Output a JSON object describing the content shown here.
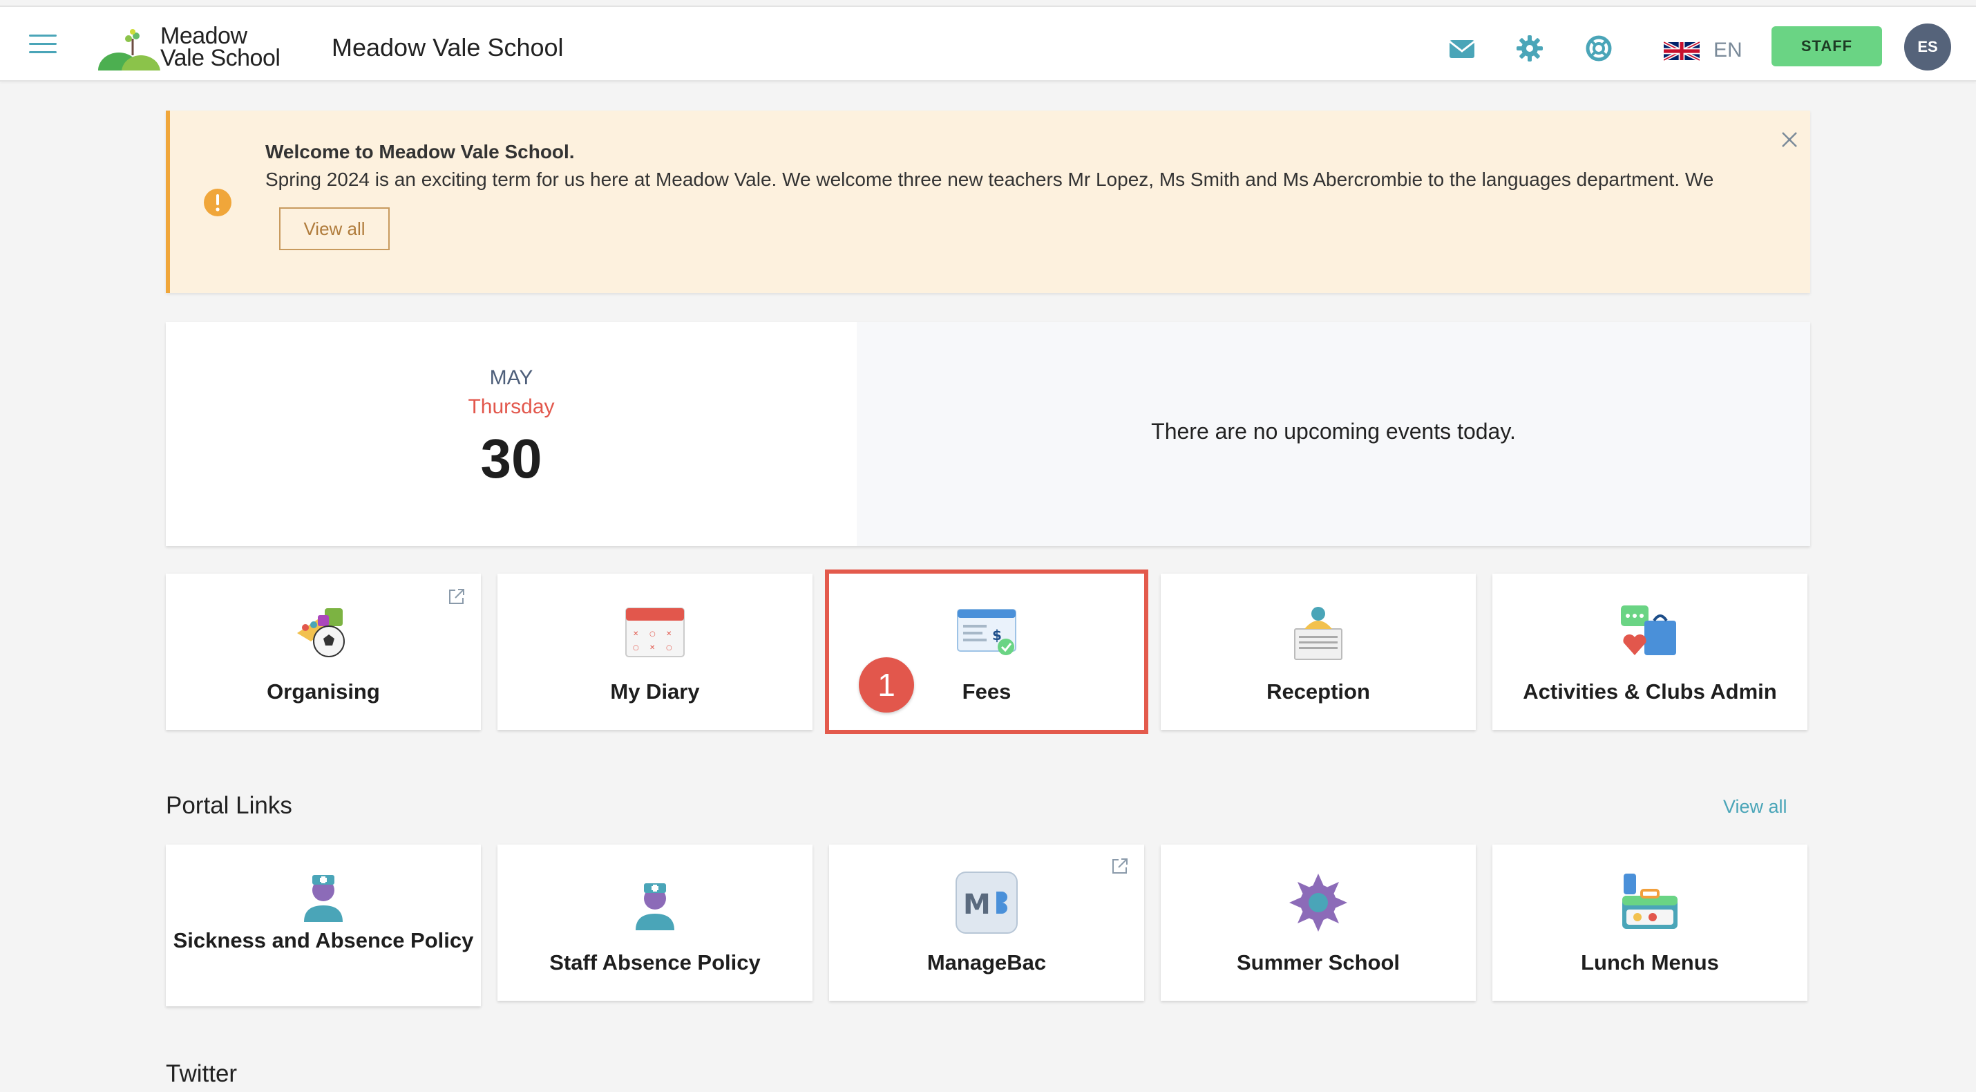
{
  "header": {
    "logo_line1": "Meadow",
    "logo_line2": "Vale School",
    "school_name": "Meadow Vale School",
    "icons": [
      "envelope-icon",
      "gear-icon",
      "lifebuoy-icon"
    ],
    "language": "EN",
    "staff_label": "STAFF",
    "avatar_initials": "ES",
    "accent_color": "#4aa5b8"
  },
  "announcement": {
    "title": "Welcome to Meadow Vale School.",
    "body": "Spring 2024 is an exciting term for us here at Meadow Vale.  We welcome three new teachers Mr Lopez, Ms Smith and Ms Abercrombie to the languages department.  We",
    "view_all": "View all",
    "accent_color": "#f0a63a"
  },
  "calendar": {
    "month": "MAY",
    "weekday": "Thursday",
    "day": "30",
    "events_message": "There are no upcoming events today."
  },
  "apps": [
    {
      "label": "Organising",
      "icon": "organising-icon",
      "external": true
    },
    {
      "label": "My Diary",
      "icon": "calendar-icon",
      "external": false
    },
    {
      "label": "Fees",
      "icon": "fees-cheque-icon",
      "external": false,
      "highlighted": true
    },
    {
      "label": "Reception",
      "icon": "reception-bell-icon",
      "external": false
    },
    {
      "label": "Activities & Clubs Admin",
      "icon": "activities-icon",
      "external": false
    }
  ],
  "step_badge": "1",
  "portal_links": {
    "title": "Portal Links",
    "view_all": "View all",
    "items": [
      {
        "label": "Sickness and Absence Policy",
        "icon": "nurse-icon",
        "external": false
      },
      {
        "label": "Staff Absence Policy",
        "icon": "nurse-icon",
        "external": false
      },
      {
        "label": "ManageBac",
        "icon": "managebac-logo-icon",
        "external": true
      },
      {
        "label": "Summer School",
        "icon": "sun-icon",
        "external": false
      },
      {
        "label": "Lunch Menus",
        "icon": "lunchbox-icon",
        "external": false
      }
    ]
  },
  "twitter": {
    "title": "Twitter"
  }
}
